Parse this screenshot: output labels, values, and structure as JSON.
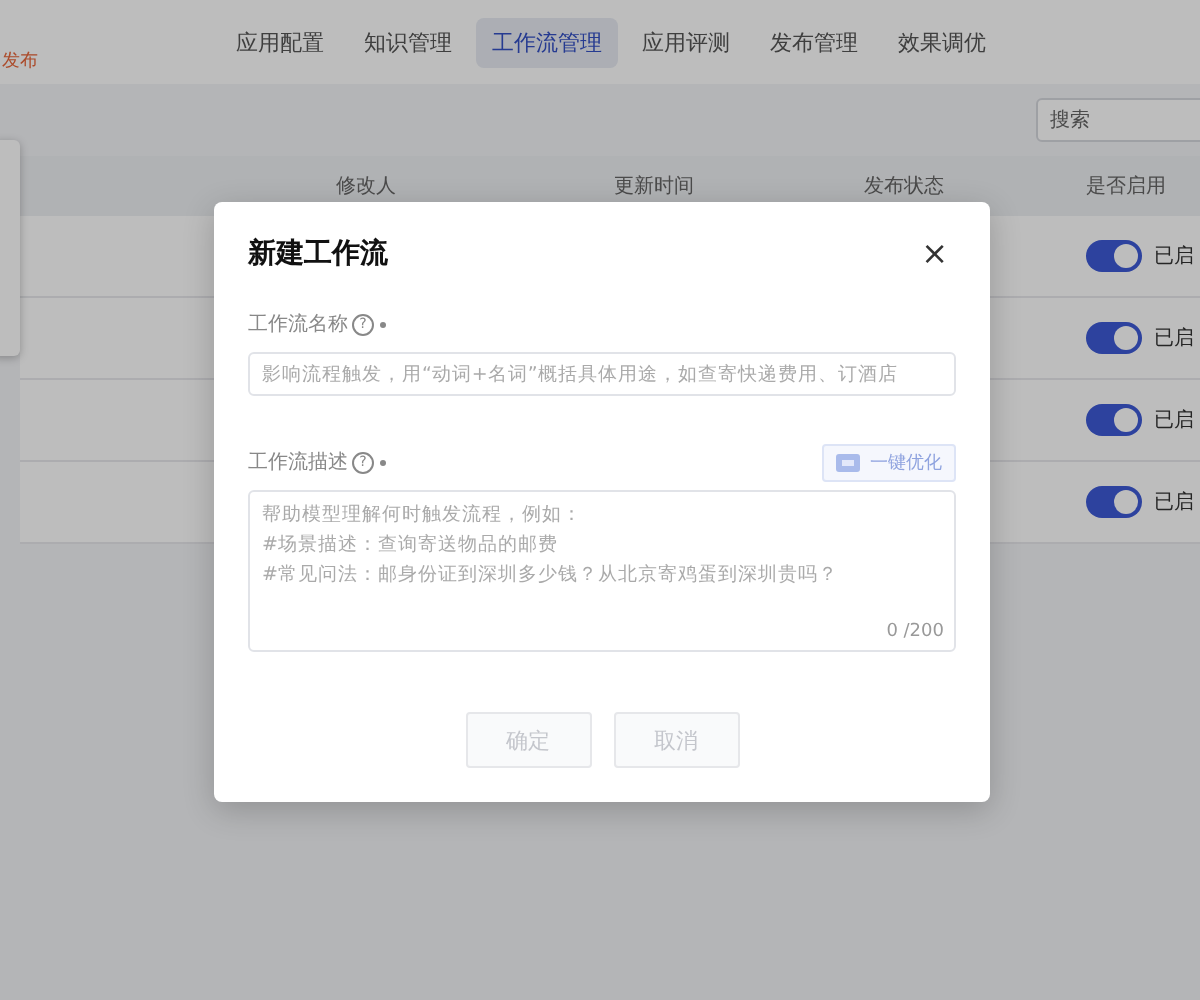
{
  "header": {
    "status_tag": "发布",
    "tabs": [
      {
        "label": "应用配置",
        "selected": false
      },
      {
        "label": "知识管理",
        "selected": false
      },
      {
        "label": "工作流管理",
        "selected": true
      },
      {
        "label": "应用评测",
        "selected": false
      },
      {
        "label": "发布管理",
        "selected": false
      },
      {
        "label": "效果调优",
        "selected": false
      }
    ]
  },
  "search": {
    "placeholder": "搜索"
  },
  "table": {
    "columns": [
      "修改人",
      "更新时间",
      "发布状态",
      "是否启用"
    ],
    "rows": [
      {
        "enabled": true,
        "enabled_label": "已启"
      },
      {
        "enabled": true,
        "enabled_label": "已启"
      },
      {
        "enabled": true,
        "enabled_label": "已启"
      },
      {
        "enabled": true,
        "enabled_label": "已启"
      }
    ]
  },
  "dialog": {
    "title": "新建工作流",
    "close": "×",
    "fields": [
      {
        "kind": "input",
        "label": "工作流名称",
        "help": "?",
        "required": true,
        "placeholder": "影响流程触发，用“动词+名词”概括具体用途，如查寄快递费用、订酒店"
      },
      {
        "kind": "textarea",
        "label": "工作流描述",
        "help": "?",
        "required": true,
        "action": "一键优化",
        "placeholder": "帮助模型理解何时触发流程，例如：\n#场景描述：查询寄送物品的邮费\n#常见问法：邮身份证到深圳多少钱？从北京寄鸡蛋到深圳贵吗？",
        "counter": "0 /200"
      }
    ],
    "buttons": [
      {
        "label": "确定",
        "disabled": true
      },
      {
        "label": "取消",
        "disabled": true
      }
    ]
  }
}
